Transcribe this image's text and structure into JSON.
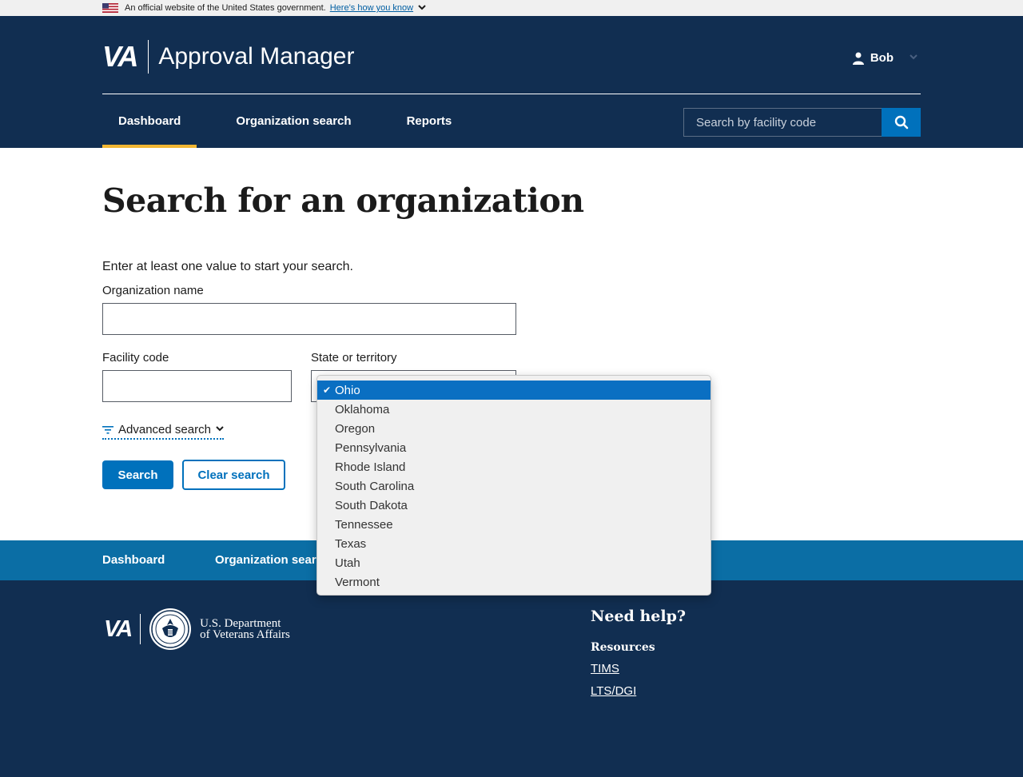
{
  "banner": {
    "text": "An official website of the United States government.",
    "link": "Here’s how you know",
    "flag_icon": "us-flag-icon"
  },
  "header": {
    "logo": "VA",
    "title": "Approval Manager",
    "user": "Bob",
    "nav": [
      {
        "label": "Dashboard",
        "active": true
      },
      {
        "label": "Organization search",
        "active": false
      },
      {
        "label": "Reports",
        "active": false
      }
    ],
    "search_placeholder": "Search by facility code"
  },
  "main": {
    "title": "Search for an organization",
    "intro": "Enter at least one value to start your search.",
    "org_label": "Organization name",
    "org_value": "",
    "facility_label": "Facility code",
    "facility_value": "",
    "state_label": "State or territory",
    "advanced": "Advanced search",
    "search_button": "Search",
    "clear_button": "Clear search"
  },
  "dropdown": {
    "selected": "Ohio",
    "options": [
      "Ohio",
      "Oklahoma",
      "Oregon",
      "Pennsylvania",
      "Rhode Island",
      "South Carolina",
      "South Dakota",
      "Tennessee",
      "Texas",
      "Utah",
      "Vermont"
    ]
  },
  "footer": {
    "nav": [
      "Dashboard",
      "Organization search"
    ],
    "logo": "VA",
    "dept_line1": "U.S. Department",
    "dept_line2": "of Veterans Affairs",
    "help_title": "Need help?",
    "resources_title": "Resources",
    "links": [
      "TIMS",
      "LTS/DGI"
    ]
  },
  "colors": {
    "header_bg": "#112e51",
    "accent_blue": "#0071bc",
    "active_underline": "#f2b632",
    "footer_nav_bg": "#0b6ea5"
  }
}
